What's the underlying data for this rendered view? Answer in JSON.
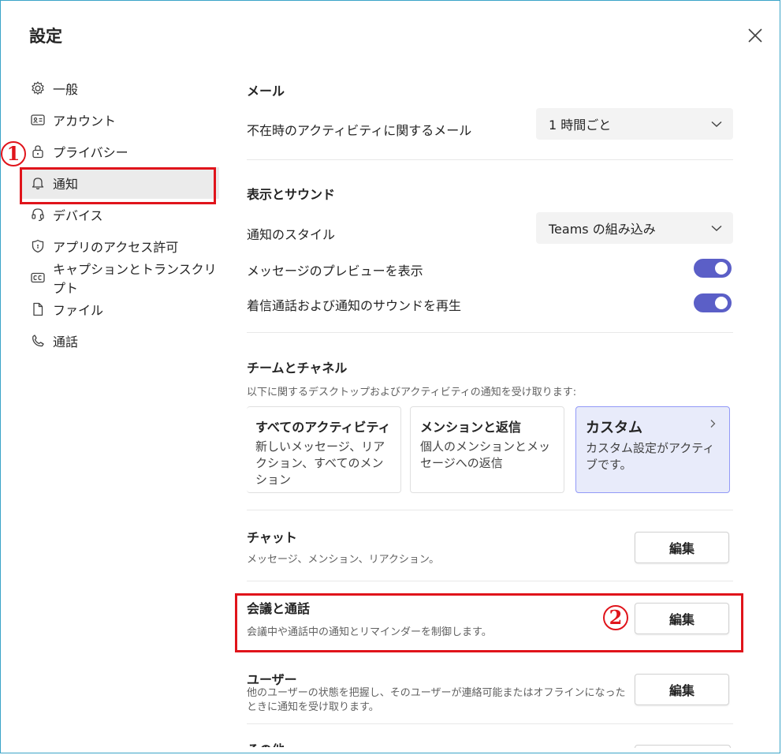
{
  "dialog": {
    "title": "設定"
  },
  "sidebar": {
    "items": [
      {
        "label": "一般",
        "icon": "gear-icon"
      },
      {
        "label": "アカウント",
        "icon": "id-card-icon"
      },
      {
        "label": "プライバシー",
        "icon": "lock-icon"
      },
      {
        "label": "通知",
        "icon": "bell-icon",
        "active": true
      },
      {
        "label": "デバイス",
        "icon": "headset-icon"
      },
      {
        "label": "アプリのアクセス許可",
        "icon": "shield-icon"
      },
      {
        "label": "キャプションとトランスクリプト",
        "icon": "cc-icon"
      },
      {
        "label": "ファイル",
        "icon": "file-icon"
      },
      {
        "label": "通話",
        "icon": "phone-icon"
      }
    ]
  },
  "annotations": {
    "one": "1",
    "two": "2",
    "color": "#e0141b"
  },
  "mail": {
    "title": "メール",
    "label": "不在時のアクティビティに関するメール",
    "value": "1 時間ごと"
  },
  "display": {
    "title": "表示とサウンド",
    "style_label": "通知のスタイル",
    "style_value": "Teams の組み込み",
    "preview_label": "メッセージのプレビューを表示",
    "preview_on": true,
    "sound_label": "着信通話および通知のサウンドを再生",
    "sound_on": true
  },
  "teams": {
    "title": "チームとチャネル",
    "subtitle": "以下に関するデスクトップおよびアクティビティの通知を受け取ります:",
    "cards": [
      {
        "title": "すべてのアクティビティ",
        "desc": "新しいメッセージ、リアクション、すべてのメンション"
      },
      {
        "title": "メンションと返信",
        "desc": "個人のメンションとメッセージへの返信"
      },
      {
        "title": "カスタム",
        "desc": "カスタム設定がアクティブです。",
        "selected": true
      }
    ]
  },
  "chat": {
    "title": "チャット",
    "desc": "メッセージ、メンション、リアクション。",
    "button": "編集"
  },
  "meetings": {
    "title": "会議と通話",
    "desc": "会議中や通話中の通知とリマインダーを制御します。",
    "button": "編集"
  },
  "users": {
    "title": "ユーザー",
    "desc": "他のユーザーの状態を把握し、そのユーザーが連絡可能またはオフラインになったときに通知を受け取ります。",
    "button": "編集"
  },
  "other": {
    "title": "その他"
  },
  "colors": {
    "accent": "#5b5fc7",
    "selected_card": "#e8ebfa",
    "frame": "#3aa4c8"
  }
}
